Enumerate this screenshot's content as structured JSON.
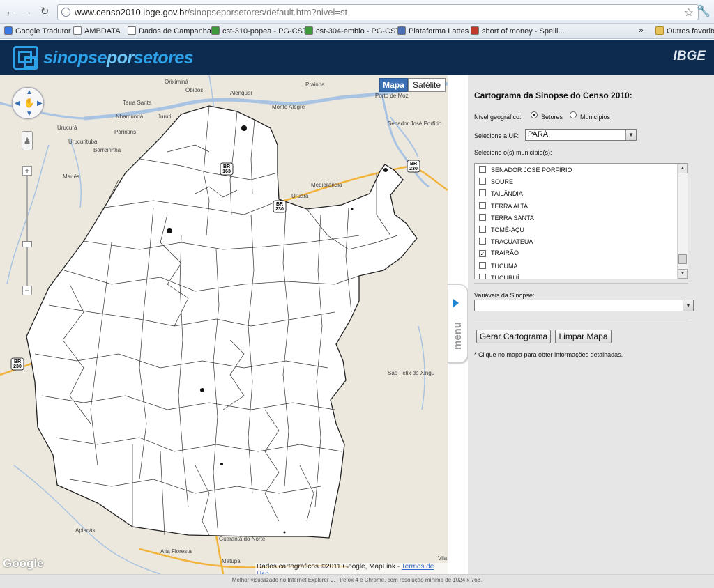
{
  "browser": {
    "url_host": "www.censo2010.ibge.gov.br",
    "url_path": "/sinopseporsetores/default.htm?nivel=st",
    "bookmarks": [
      {
        "label": "Google Tradutor",
        "icon": "translate-icon",
        "color": "#3b78e7"
      },
      {
        "label": "AMBDATA",
        "icon": "page-icon",
        "color": "#ffffff"
      },
      {
        "label": "Dados de Campanha",
        "icon": "page-icon",
        "color": "#ffffff"
      },
      {
        "label": "cst-310-popea - PG-CST",
        "icon": "leaf-icon",
        "color": "#3e9a3a"
      },
      {
        "label": "cst-304-embio - PG-CST",
        "icon": "leaf-icon",
        "color": "#3e9a3a"
      },
      {
        "label": "Plataforma Lattes",
        "icon": "lattes-icon",
        "color": "#4a6fb5"
      },
      {
        "label": "short of money - Spelli...",
        "icon": "crest-icon",
        "color": "#c0392b"
      }
    ],
    "more": "»",
    "other_favorites": "Outros favoritos"
  },
  "header": {
    "logo_part1": "sinopse",
    "logo_part2": "por",
    "logo_part3": "setores",
    "brand": "IBGE"
  },
  "map": {
    "type_map": "Mapa",
    "type_satellite": "Satélite",
    "google": "Google",
    "attribution": "Dados cartográficos ©2011 Google, MapLink - ",
    "terms": "Termos de Uso",
    "places": [
      {
        "name": "Oriximiná"
      },
      {
        "name": "Óbidos"
      },
      {
        "name": "Alenquer"
      },
      {
        "name": "Prainha"
      },
      {
        "name": "Porto de Moz"
      },
      {
        "name": "Monte Alegre"
      },
      {
        "name": "Terra Santa"
      },
      {
        "name": "Nhamundá"
      },
      {
        "name": "Juruti"
      },
      {
        "name": "Urucurá"
      },
      {
        "name": "Parintins"
      },
      {
        "name": "Urucurituba"
      },
      {
        "name": "Barreirinha"
      },
      {
        "name": "Maués"
      },
      {
        "name": "Senador José Porfírio"
      },
      {
        "name": "Uruará"
      },
      {
        "name": "Medicilândia"
      },
      {
        "name": "São Félix do Xingu"
      },
      {
        "name": "Apiacás"
      },
      {
        "name": "Guarantã do Norte"
      },
      {
        "name": "Alta Floresta"
      },
      {
        "name": "Matupá"
      },
      {
        "name": "Vila"
      }
    ],
    "shields": [
      {
        "name": "BR 230"
      },
      {
        "name": "BR 230"
      },
      {
        "name": "BR 230"
      },
      {
        "name": "BR 163"
      }
    ],
    "menu_tab": "menu"
  },
  "panel": {
    "title": "Cartograma da Sinopse do Censo 2010:",
    "level_label": "Nível geográfico:",
    "level_setores": "Setores",
    "level_municipios": "Municípios",
    "uf_label": "Selecione a UF:",
    "uf_value": "PARÁ",
    "municipios_label": "Selecione o(s) município(s):",
    "municipios": [
      {
        "name": "SENADOR JOSÉ PORFÍRIO",
        "checked": false
      },
      {
        "name": "SOURE",
        "checked": false
      },
      {
        "name": "TAILÂNDIA",
        "checked": false
      },
      {
        "name": "TERRA ALTA",
        "checked": false
      },
      {
        "name": "TERRA SANTA",
        "checked": false
      },
      {
        "name": "TOMÉ-AÇU",
        "checked": false
      },
      {
        "name": "TRACUATEUA",
        "checked": false
      },
      {
        "name": "TRAIRÃO",
        "checked": true
      },
      {
        "name": "TUCUMÃ",
        "checked": false
      },
      {
        "name": "TUCURUÍ",
        "checked": false
      }
    ],
    "variaveis_label": "Variáveis da Sinopse:",
    "variaveis_value": "",
    "btn_gerar": "Gerar Cartograma",
    "btn_limpar": "Limpar Mapa",
    "note": "* Clique no mapa para obter informações detalhadas."
  },
  "footer": {
    "text": "Melhor visualizado no Internet Explorer 9, Firefox 4 e Chrome, com resolução mínima de 1024 x 768."
  },
  "colors": {
    "header_bg": "#0d2a4f",
    "logo_blue": "#2ea2e8",
    "map_bg": "#ece8dd",
    "highway": "#f2b33d",
    "river": "#a9c3e3",
    "panel_bg": "#e6e6e6"
  }
}
